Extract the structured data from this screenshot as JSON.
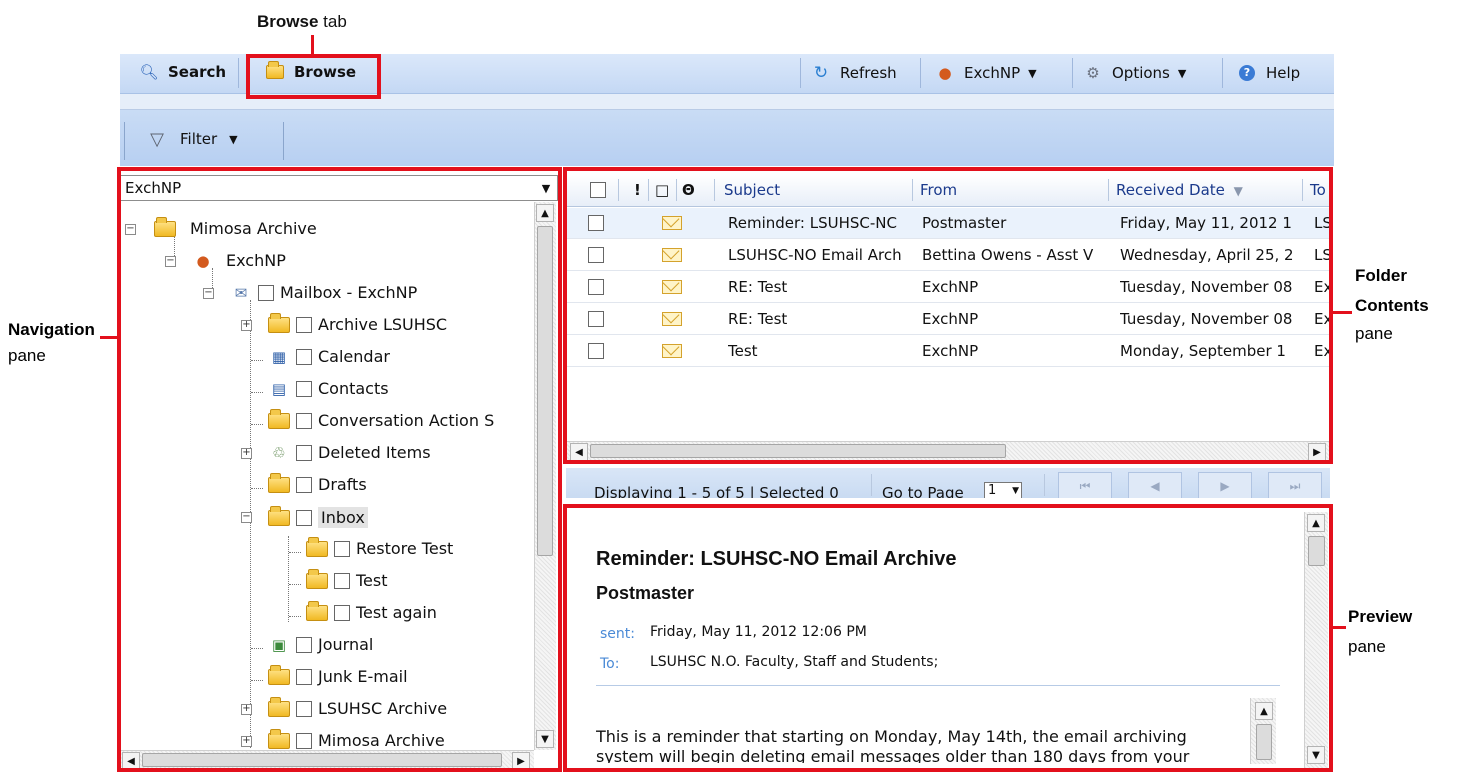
{
  "annotations": {
    "browse_tab": {
      "bold": "Browse",
      "rest": " tab"
    },
    "navigation": {
      "title": "Navigation",
      "sub": "pane"
    },
    "folder_contents": {
      "title1": "Folder",
      "title2": "Contents",
      "sub": "pane"
    },
    "preview": {
      "title": "Preview",
      "sub": "pane"
    }
  },
  "toolbar": {
    "search": "Search",
    "browse": "Browse",
    "refresh": "Refresh",
    "account": "ExchNP",
    "options": "Options",
    "help": "Help",
    "filter": "Filter"
  },
  "nav": {
    "account_select": "ExchNP",
    "tree": {
      "root": "Mimosa Archive",
      "user": "ExchNP",
      "mailbox": "Mailbox - ExchNP",
      "archive_lsuhsc": "Archive LSUHSC",
      "calendar": "Calendar",
      "contacts": "Contacts",
      "conversation": "Conversation Action S",
      "deleted": "Deleted Items",
      "drafts": "Drafts",
      "inbox": "Inbox",
      "restore_test": "Restore Test",
      "test": "Test",
      "test_again": "Test again",
      "journal": "Journal",
      "junk": "Junk E-mail",
      "lsuhsc_archive": "LSUHSC Archive",
      "mimosa_archive": "Mimosa Archive"
    }
  },
  "contents": {
    "columns": {
      "importance": "!",
      "type": "□",
      "attach": "Θ",
      "subject": "Subject",
      "from": "From",
      "received": "Received Date",
      "to": "To"
    },
    "rows": [
      {
        "subject": "Reminder: LSUHSC-NC",
        "from": "Postmaster",
        "received": "Friday, May 11, 2012 1",
        "to": "LS"
      },
      {
        "subject": "LSUHSC-NO Email Arch",
        "from": "Bettina Owens - Asst V",
        "received": "Wednesday, April 25, 2",
        "to": "LS"
      },
      {
        "subject": "RE: Test",
        "from": "ExchNP",
        "received": "Tuesday, November 08",
        "to": "Ex"
      },
      {
        "subject": "RE: Test",
        "from": "ExchNP",
        "received": "Tuesday, November 08",
        "to": "Ex"
      },
      {
        "subject": "Test",
        "from": "ExchNP",
        "received": "Monday, September 1",
        "to": "Ex"
      }
    ],
    "pager": {
      "status": "Displaying 1 - 5 of 5 | Selected 0",
      "goto": "Go to Page",
      "page": "1"
    }
  },
  "preview": {
    "title": "Reminder: LSUHSC-NO Email Archive",
    "from": "Postmaster",
    "sent_label": "sent:",
    "sent_value": "Friday, May 11, 2012 12:06 PM",
    "to_label": "To:",
    "to_value": "LSUHSC N.O. Faculty, Staff and Students;",
    "body_line1": "This is a reminder that starting on Monday, May 14th, the email archiving",
    "body_line2": "system will begin deleting email messages older than 180 days from your"
  },
  "colors": {
    "annotation_red": "#e3101c",
    "toolbar_blue": "#c4d8f4",
    "link_blue": "#1b3a8c"
  }
}
